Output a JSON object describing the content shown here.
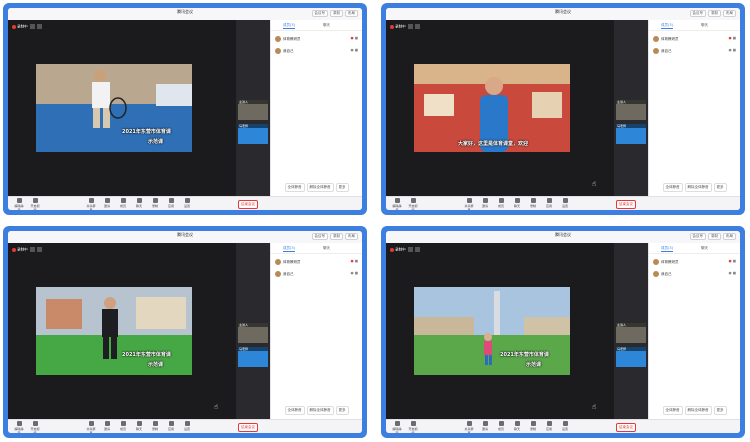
{
  "window": {
    "title": "腾讯会议",
    "titlebar_right": [
      "会议号",
      "录制",
      "布局"
    ]
  },
  "panels": [
    {
      "status_text": "录制中",
      "caption": "2021年东营市体育课",
      "caption_line2": "示范课",
      "scene": "tennis",
      "side_tiles": [
        {
          "label": "主讲人"
        },
        {
          "label": "马老师"
        }
      ],
      "members": [
        {
          "name": "体育教研员"
        },
        {
          "name": "我自己"
        }
      ],
      "tabs": [
        "成员(3)",
        "聊天"
      ],
      "footer_buttons": [
        "全体静音",
        "解除全体静音",
        "更多"
      ],
      "toolbar": [
        "解除静音",
        "开启视频",
        "共享屏幕",
        "邀请",
        "成员",
        "聊天",
        "录制",
        "应用",
        "设置"
      ],
      "end_button": "结束会议",
      "show_thumb": false
    },
    {
      "status_text": "录制中",
      "caption": "大家好，这里是体育课堂，欢迎",
      "caption_line2": "",
      "scene": "indoor",
      "side_tiles": [
        {
          "label": "主讲人"
        },
        {
          "label": "马老师"
        }
      ],
      "members": [
        {
          "name": "体育教研员"
        },
        {
          "name": "我自己"
        }
      ],
      "tabs": [
        "成员(3)",
        "聊天"
      ],
      "footer_buttons": [
        "全体静音",
        "解除全体静音",
        "更多"
      ],
      "toolbar": [
        "解除静音",
        "开启视频",
        "共享屏幕",
        "邀请",
        "成员",
        "聊天",
        "录制",
        "应用",
        "设置"
      ],
      "end_button": "结束会议",
      "show_thumb": true
    },
    {
      "status_text": "录制中",
      "caption": "2021年东营市体育课",
      "caption_line2": "示范课",
      "scene": "field",
      "side_tiles": [
        {
          "label": "主讲人"
        },
        {
          "label": "马老师"
        }
      ],
      "members": [
        {
          "name": "体育教研员"
        },
        {
          "name": "我自己"
        }
      ],
      "tabs": [
        "成员(3)",
        "聊天"
      ],
      "footer_buttons": [
        "全体静音",
        "解除全体静音",
        "更多"
      ],
      "toolbar": [
        "解除静音",
        "开启视频",
        "共享屏幕",
        "邀请",
        "成员",
        "聊天",
        "录制",
        "应用",
        "设置"
      ],
      "end_button": "结束会议",
      "show_thumb": true
    },
    {
      "status_text": "录制中",
      "caption": "2021年东营市体育课",
      "caption_line2": "示范课",
      "scene": "plaza",
      "side_tiles": [
        {
          "label": "主讲人"
        },
        {
          "label": "马老师"
        }
      ],
      "members": [
        {
          "name": "体育教研员"
        },
        {
          "name": "我自己"
        }
      ],
      "tabs": [
        "成员(3)",
        "聊天"
      ],
      "footer_buttons": [
        "全体静音",
        "解除全体静音",
        "更多"
      ],
      "toolbar": [
        "解除静音",
        "开启视频",
        "共享屏幕",
        "邀请",
        "成员",
        "聊天",
        "录制",
        "应用",
        "设置"
      ],
      "end_button": "结束会议",
      "show_thumb": true
    }
  ],
  "colors": {
    "frame": "#3d7fe0",
    "stage_bg": "#1b1b1d",
    "danger": "#e53935"
  }
}
